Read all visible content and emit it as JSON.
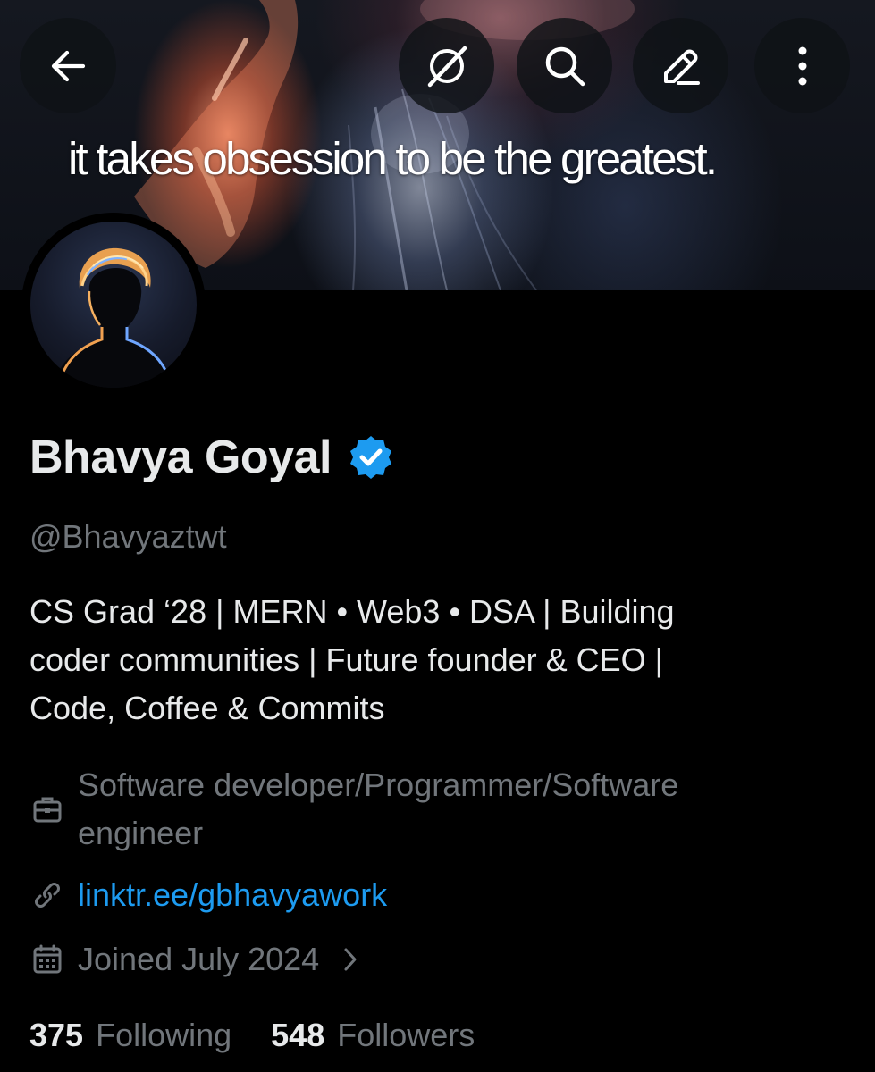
{
  "banner": {
    "quote": "it takes obsession to be the greatest."
  },
  "header": {
    "back_icon": "arrow-left-icon",
    "grok_icon": "grok-icon",
    "search_icon": "search-icon",
    "edit_icon": "pencil-icon",
    "more_icon": "more-vertical-icon"
  },
  "profile": {
    "name": "Bhavya Goyal",
    "verified": true,
    "handle": "@Bhavyaztwt",
    "bio_lines": [
      "CS Grad ‘28 | MERN • Web3 • DSA | Building",
      "coder communities | Future founder & CEO |",
      "Code, Coffee & Commits"
    ],
    "profession_lines": [
      "Software developer/Programmer/Software",
      "engineer"
    ],
    "link": "linktr.ee/gbhavyawork",
    "joined": "Joined July 2024",
    "following_count": "375",
    "following_label": "Following",
    "followers_count": "548",
    "followers_label": "Followers"
  },
  "colors": {
    "background": "#000000",
    "primary_text": "#e7e9ea",
    "secondary_text": "#71767b",
    "link": "#1d9bf0",
    "verified_badge": "#1d9bf0"
  }
}
